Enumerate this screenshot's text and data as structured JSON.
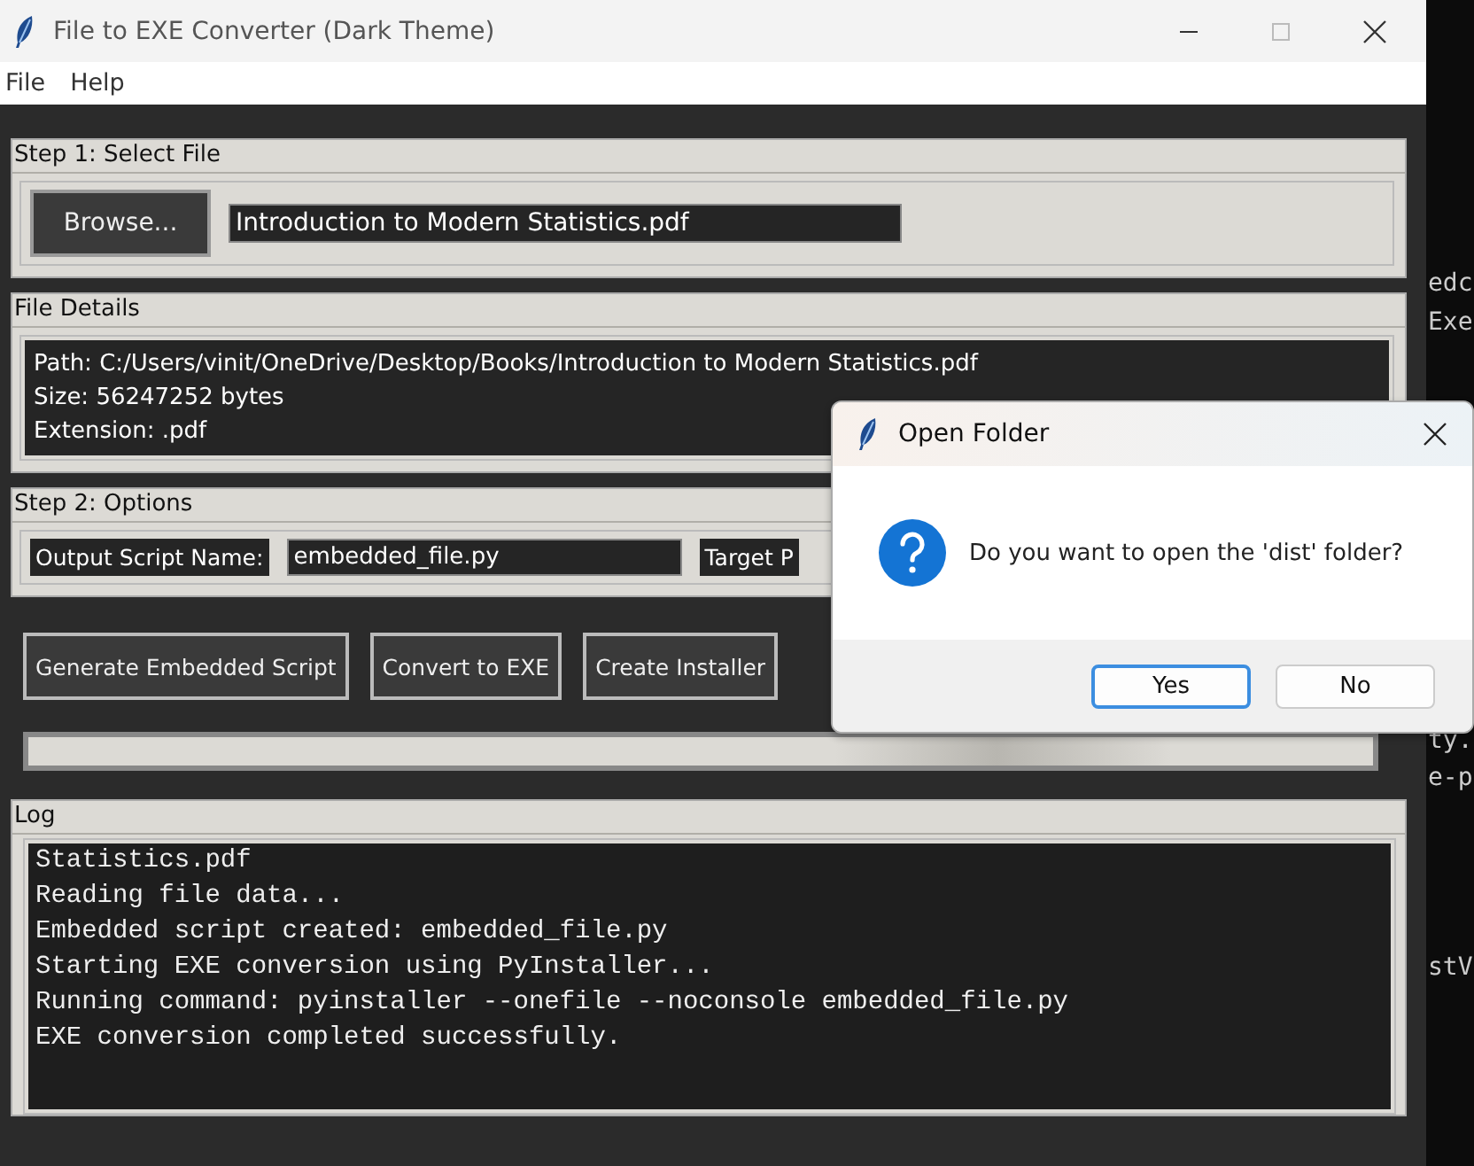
{
  "window": {
    "title": "File to EXE Converter (Dark Theme)"
  },
  "menu": [
    "File",
    "Help"
  ],
  "step1": {
    "title": "Step 1: Select File",
    "browse_button": "Browse...",
    "file_field": {
      "value": "Introduction to Modern Statistics.pdf"
    }
  },
  "file_details": {
    "title": "File Details",
    "lines": [
      "Path: C:/Users/vinit/OneDrive/Desktop/Books/Introduction to Modern Statistics.pdf",
      "Size: 56247252 bytes",
      "Extension: .pdf"
    ]
  },
  "step2": {
    "title": "Step 2: Options",
    "output_label": "Output Script Name:",
    "output_field": {
      "value": "embedded_file.py"
    },
    "target_label": "Target P"
  },
  "actions": [
    "Generate Embedded Script",
    "Convert to EXE",
    "Create Installer"
  ],
  "progress": {
    "level": 0
  },
  "log": {
    "title": "Log",
    "lines": [
      "Statistics.pdf",
      "Reading file data...",
      "Embedded script created: embedded_file.py",
      "Starting EXE conversion using PyInstaller...",
      "Running command: pyinstaller --onefile --noconsole embedded_file.py",
      "EXE conversion completed successfully."
    ]
  },
  "background_terminal": {
    "lines": [
      {
        "text": "edc"
      },
      {
        "text": "Exe"
      },
      {
        "text": "ty."
      },
      {
        "text": "e-p"
      },
      {
        "text": "stV"
      }
    ]
  },
  "dialog": {
    "title": "Open Folder",
    "message": "Do you want to open the 'dist' folder?",
    "buttons": [
      {
        "label": "Yes",
        "selected": true
      },
      {
        "label": "No",
        "selected": false
      }
    ]
  }
}
